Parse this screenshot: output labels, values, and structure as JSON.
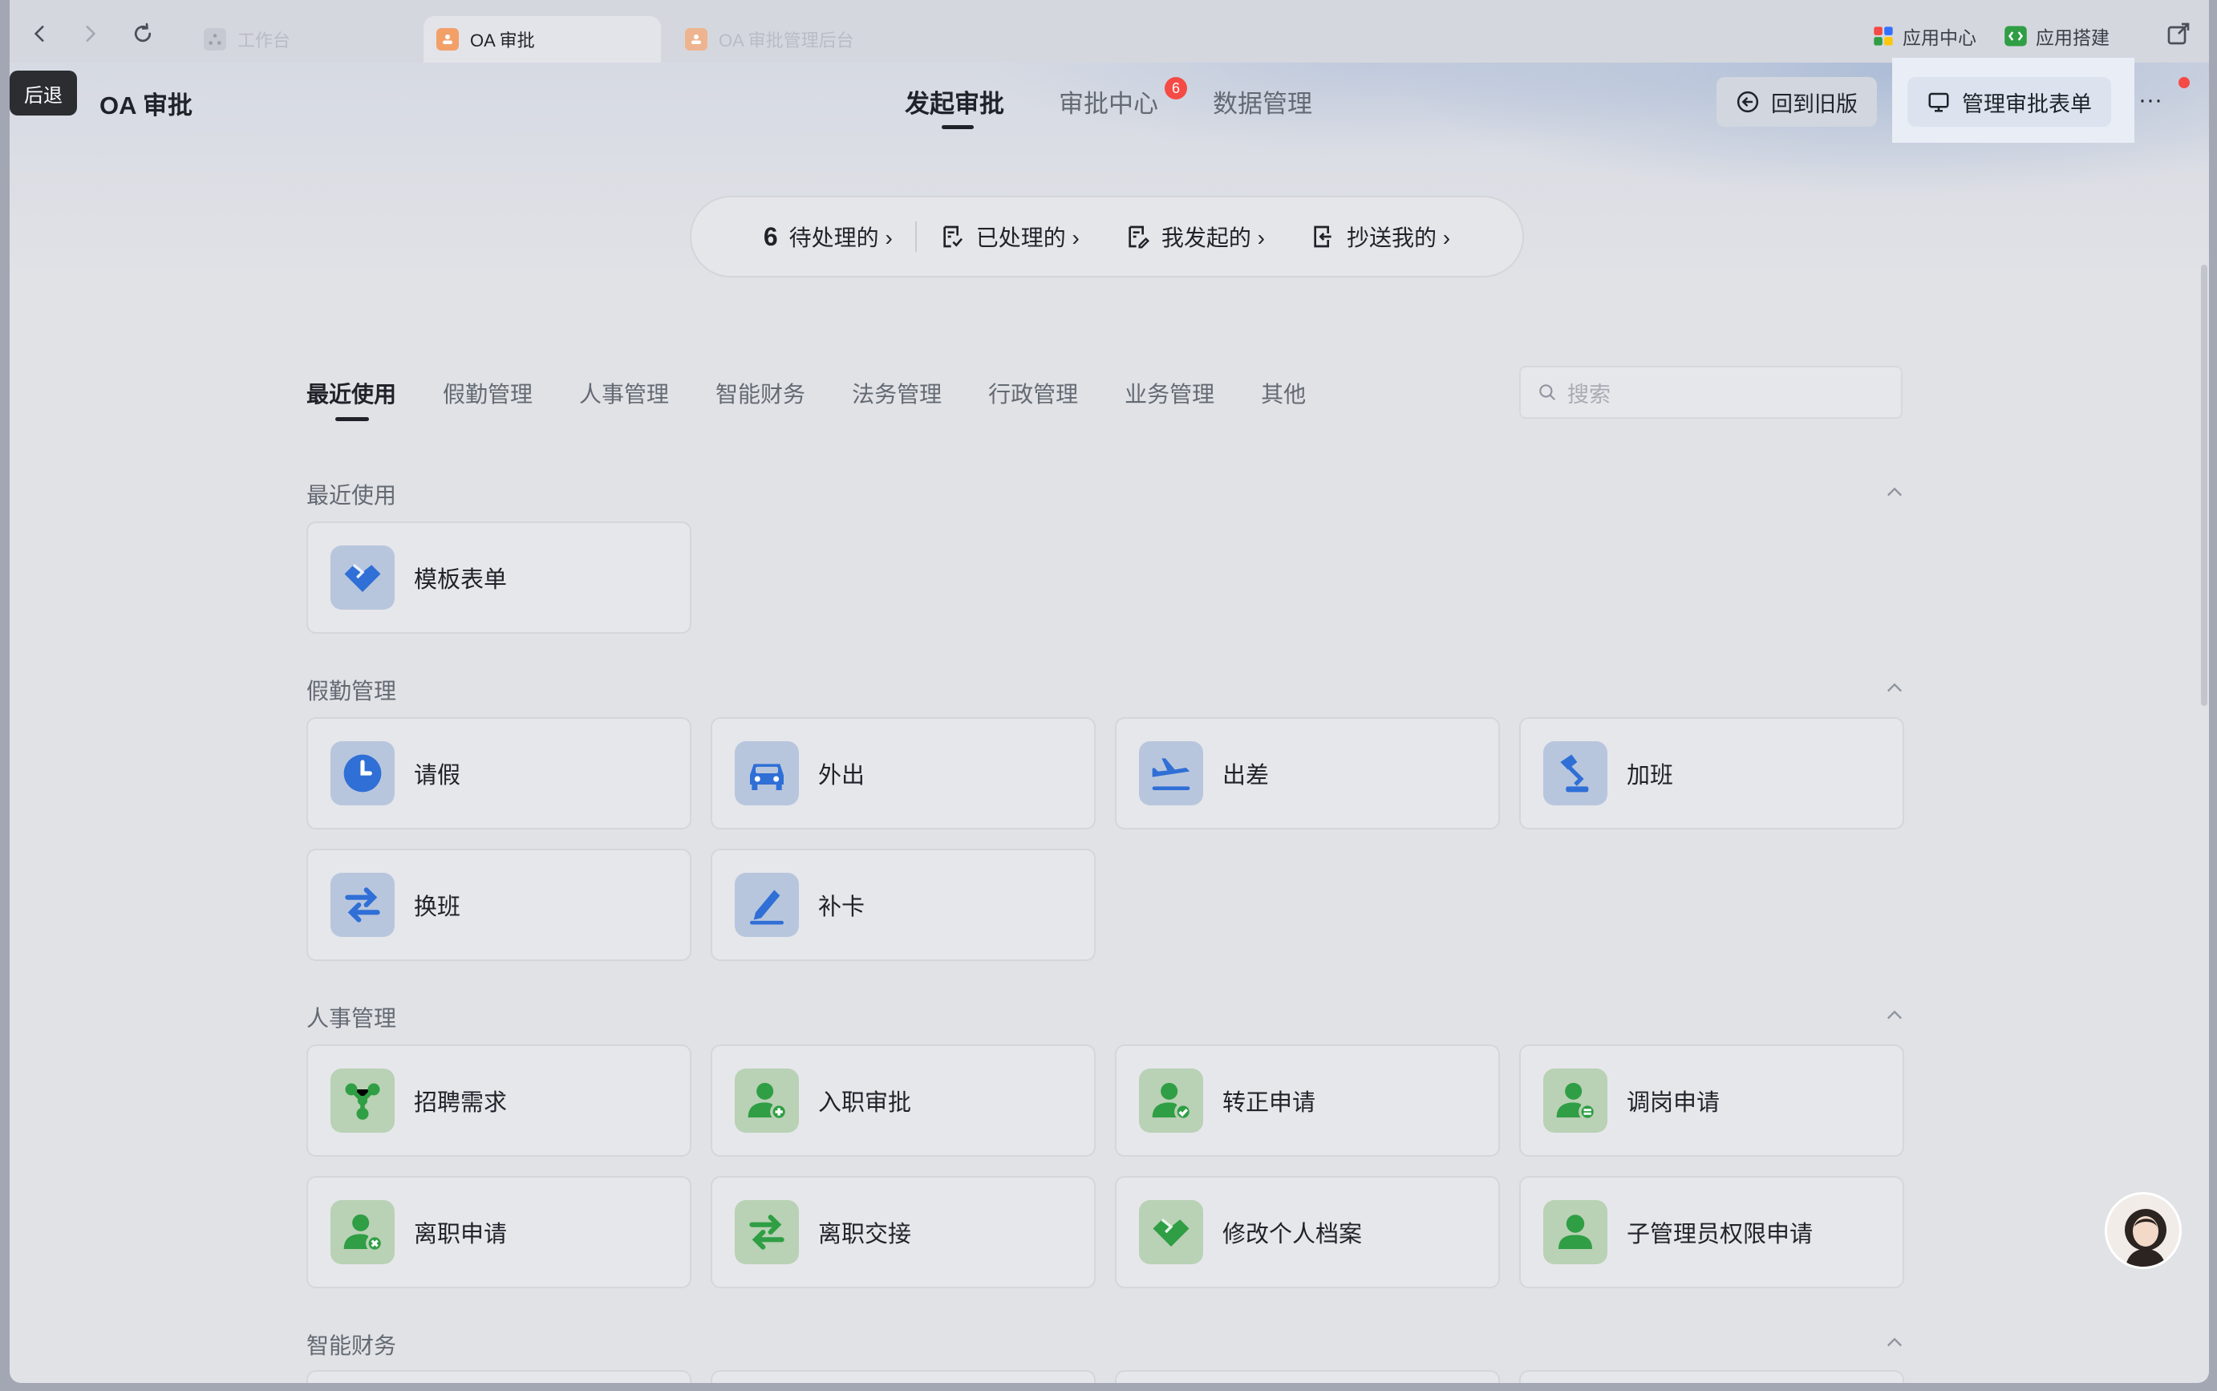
{
  "browser": {
    "tabs": [
      {
        "label": "工作台"
      },
      {
        "label": "OA 审批"
      },
      {
        "label": "OA 审批管理后台"
      }
    ],
    "top_links": [
      {
        "label": "应用中心"
      },
      {
        "label": "应用搭建"
      }
    ]
  },
  "tooltip": {
    "back": "后退"
  },
  "app": {
    "title": "OA 审批"
  },
  "main_nav": [
    {
      "label": "发起审批"
    },
    {
      "label": "审批中心"
    },
    {
      "label": "数据管理"
    }
  ],
  "approval_center_badge": "6",
  "header_buttons": {
    "old_version": "回到旧版",
    "manage_forms": "管理审批表单",
    "more": "···"
  },
  "status": {
    "pending_count": "6",
    "pending": "待处理的 ›",
    "processed": "已处理的 ›",
    "initiated": "我发起的 ›",
    "cc": "抄送我的 ›"
  },
  "category_tabs": [
    "最近使用",
    "假勤管理",
    "人事管理",
    "智能财务",
    "法务管理",
    "行政管理",
    "业务管理",
    "其他"
  ],
  "search": {
    "placeholder": "搜索"
  },
  "sections": {
    "recent": {
      "title": "最近使用",
      "items": [
        {
          "label": "模板表单",
          "icon": "handshake-icon"
        }
      ]
    },
    "attendance": {
      "title": "假勤管理",
      "items": [
        {
          "label": "请假",
          "icon": "clock-icon"
        },
        {
          "label": "外出",
          "icon": "car-icon"
        },
        {
          "label": "出差",
          "icon": "airplane-icon"
        },
        {
          "label": "加班",
          "icon": "desk-lamp-icon"
        },
        {
          "label": "换班",
          "icon": "swap-icon"
        },
        {
          "label": "补卡",
          "icon": "pen-icon"
        }
      ]
    },
    "hr": {
      "title": "人事管理",
      "items": [
        {
          "label": "招聘需求",
          "icon": "network-icon"
        },
        {
          "label": "入职审批",
          "icon": "user-add-icon"
        },
        {
          "label": "转正申请",
          "icon": "user-check-icon"
        },
        {
          "label": "调岗申请",
          "icon": "user-transfer-icon"
        },
        {
          "label": "离职申请",
          "icon": "user-remove-icon"
        },
        {
          "label": "离职交接",
          "icon": "swap-icon"
        },
        {
          "label": "修改个人档案",
          "icon": "handshake-icon"
        },
        {
          "label": "子管理员权限申请",
          "icon": "user-icon"
        }
      ]
    },
    "finance": {
      "title": "智能财务"
    }
  },
  "colors": {
    "accent_blue": "#2f6fd6",
    "accent_green": "#2f9e44",
    "badge_red": "#f54a45"
  }
}
